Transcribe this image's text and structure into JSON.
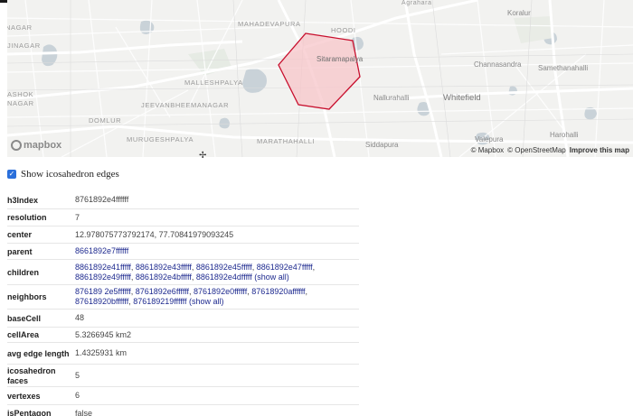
{
  "map": {
    "labels": {
      "mahadevapura": "MAHADEVAPURA",
      "hoodi": "HOODI",
      "agrahara": "Agrahara",
      "koralur": "Koralur",
      "nagar_left": "NAGAR",
      "jinagar": "JINAGAR",
      "sitaramapalya": "Sitaramapalya",
      "channasandra": "Channasandra",
      "samethanahalli": "Samethanahalli",
      "malleshpalya": "MALLESHPALYA",
      "ashok": "ASHOK",
      "nagar2": "NAGAR",
      "nallurahalli": "Nallurahalli",
      "whitefield": "Whitefield",
      "jeevan": "JEEVANBHEEMANAGAR",
      "domlur": "DOMLUR",
      "murugesh": "MURUGESHPALYA",
      "marathahalli": "MARATHAHALLI",
      "siddapura": "Siddapura",
      "valepura": "Valepura",
      "harohalli": "Harohalli"
    },
    "logo": "mapbox",
    "attribution": {
      "mapbox": "© Mapbox",
      "osm": "© OpenStreetMap",
      "improve": "Improve this map"
    },
    "hexagon": {
      "fill": "#f7c6c9",
      "stroke": "#c8102e"
    }
  },
  "toggle": {
    "label": "Show icosahedron edges",
    "checked": true
  },
  "properties": {
    "h3Index": {
      "key": "h3Index",
      "value": "8761892e4ffffff"
    },
    "resolution": {
      "key": "resolution",
      "value": "7"
    },
    "center": {
      "key": "center",
      "value": "12.978075773792174, 77.70841979093245"
    },
    "parent": {
      "key": "parent",
      "value": "8661892e7ffffff"
    },
    "children": {
      "key": "children",
      "items": [
        "8861892e41fffff",
        "8861892e43fffff",
        "8861892e45fffff",
        "8861892e47fffff",
        "8861892e49fffff",
        "8861892e4bfffff",
        "8861892e4dfffff"
      ],
      "show_all": "(show all)"
    },
    "neighbors": {
      "key": "neighbors",
      "items": [
        "876189 2e5ffffff",
        "8761892e6ffffff",
        "8761892e0ffffff",
        "87618920affffff",
        "87618920bffffff",
        "876189219ffffff"
      ],
      "show_all": "(show all)"
    },
    "baseCell": {
      "key": "baseCell",
      "value": "48"
    },
    "cellArea": {
      "key": "cellArea",
      "value": "5.3266945 km2"
    },
    "avgEdgeLength": {
      "key": "avg edge length",
      "value": "1.4325931 km"
    },
    "icosahedronFaces": {
      "key": "icosahedron faces",
      "value": "5"
    },
    "vertexes": {
      "key": "vertexes",
      "value": "6"
    },
    "isPentagon": {
      "key": "isPentagon",
      "value": "false"
    }
  }
}
